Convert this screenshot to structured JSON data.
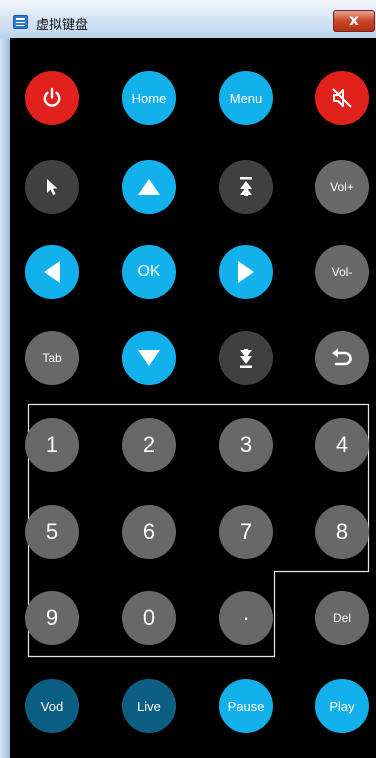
{
  "window": {
    "title": "虚拟键盘",
    "close_label": "x"
  },
  "colors": {
    "red": "#e0211c",
    "blue": "#13b1ec",
    "dark": "#404040",
    "gray": "#686868",
    "teal": "#0d5f82",
    "background": "#000000"
  },
  "buttons": {
    "home": "Home",
    "menu": "Menu",
    "vol_up": "Vol+",
    "ok": "OK",
    "vol_down": "Vol-",
    "tab": "Tab",
    "num_1": "1",
    "num_2": "2",
    "num_3": "3",
    "num_4": "4",
    "num_5": "5",
    "num_6": "6",
    "num_7": "7",
    "num_8": "8",
    "num_9": "9",
    "num_0": "0",
    "dot": "·",
    "del": "Del",
    "vod": "Vod",
    "live": "Live",
    "pause": "Pause",
    "play": "Play"
  },
  "icons": {
    "power": "power-icon",
    "mute": "mute-icon",
    "pointer": "mouse-pointer-icon",
    "up": "arrow-up-icon",
    "page_up": "page-up-icon",
    "left": "arrow-left-icon",
    "right": "arrow-right-icon",
    "down": "arrow-down-icon",
    "page_down": "page-down-icon",
    "back": "back-icon"
  }
}
